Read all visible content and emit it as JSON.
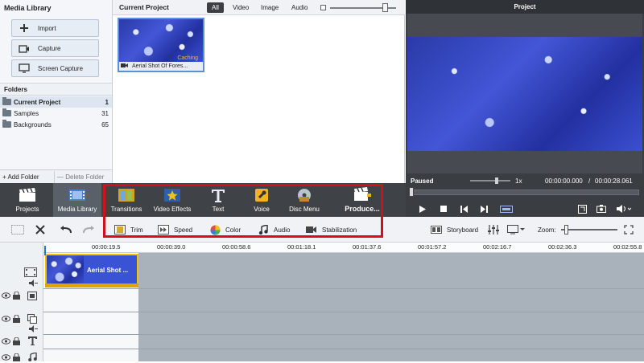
{
  "left": {
    "title": "Media Library",
    "buttons": [
      "Import",
      "Capture",
      "Screen Capture"
    ],
    "folders_title": "Folders",
    "folders": [
      {
        "name": "Current Project",
        "count": "1"
      },
      {
        "name": "Samples",
        "count": "31"
      },
      {
        "name": "Backgrounds",
        "count": "65"
      }
    ],
    "add_folder": "+ Add Folder",
    "delete_folder": "— Delete Folder"
  },
  "middle": {
    "title": "Current Project",
    "filters": [
      "All",
      "Video",
      "Image",
      "Audio"
    ],
    "clip_caption": "Aerial Shot Of Fores...",
    "caching": "Caching"
  },
  "preview": {
    "title": "Project",
    "status": "Paused",
    "speed": "1x",
    "time_current": "00:00:00.000",
    "time_total": "00:00:28.061"
  },
  "toolbar": {
    "items": [
      "Projects",
      "Media Library",
      "Transitions",
      "Video Effects",
      "Text",
      "Voice",
      "Disc Menu",
      "Produce..."
    ]
  },
  "edit_bar": {
    "tools": [
      "Trim",
      "Speed",
      "Color",
      "Audio",
      "Stabilization"
    ],
    "storyboard": "Storyboard",
    "zoom": "Zoom:"
  },
  "timeline": {
    "ticks": [
      "00:00:19.5",
      "00:00:39.0",
      "00:00:58.6",
      "00:01:18.1",
      "00:01:37.6",
      "00:01:57.2",
      "00:02:16.7",
      "00:02:36.3",
      "00:02:55.8"
    ],
    "clip_label": "Aerial Shot ..."
  },
  "colors": {
    "highlight": "#d0111b",
    "clip_border": "#f2c300",
    "toolbar_bg": "#3f4348"
  }
}
